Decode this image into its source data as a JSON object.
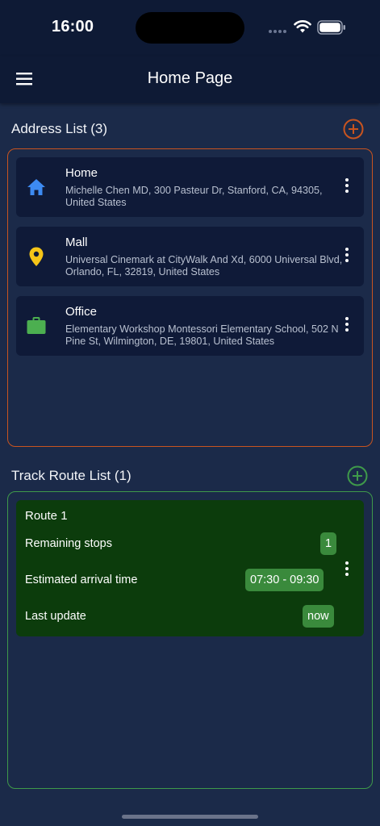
{
  "status": {
    "time": "16:00"
  },
  "appbar": {
    "title": "Home Page"
  },
  "addresses": {
    "title": "Address List (3)",
    "accent": "#c9541f",
    "items": [
      {
        "icon": "home-icon",
        "icon_color": "#3d8bf2",
        "title": "Home",
        "address": "Michelle Chen MD, 300 Pasteur Dr, Stanford, CA, 94305, United States"
      },
      {
        "icon": "location-pin-icon",
        "icon_color": "#f5c518",
        "title": "Mall",
        "address": "Universal Cinemark at CityWalk And Xd, 6000 Universal Blvd, Orlando, FL, 32819, United States"
      },
      {
        "icon": "briefcase-icon",
        "icon_color": "#4caf50",
        "title": "Office",
        "address": "Elementary Workshop Montessori Elementary School, 502 N Pine St, Wilmington, DE, 19801, United States"
      }
    ]
  },
  "routes": {
    "title": "Track Route List (1)",
    "accent": "#3f9a4a",
    "items": [
      {
        "title": "Route 1",
        "remaining_label": "Remaining stops",
        "remaining_value": "1",
        "eta_label": "Estimated arrival time",
        "eta_value": "07:30 - 09:30",
        "update_label": "Last update",
        "update_value": "now"
      }
    ]
  }
}
